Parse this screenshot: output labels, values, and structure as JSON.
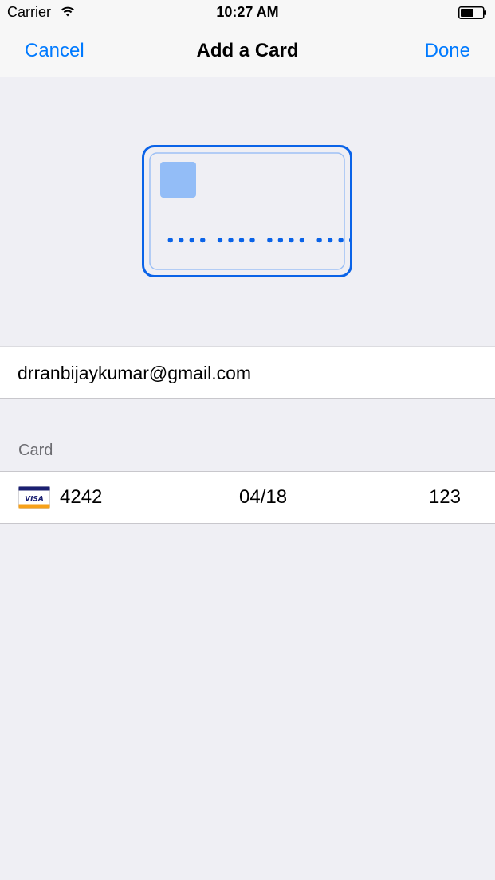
{
  "status_bar": {
    "carrier": "Carrier",
    "time": "10:27 AM",
    "icons": [
      "wifi-icon",
      "battery-icon"
    ]
  },
  "nav": {
    "cancel_label": "Cancel",
    "title": "Add a Card",
    "done_label": "Done"
  },
  "card_illustration": {
    "number_mask": "•••• •••• •••• ••••"
  },
  "email_field": {
    "value": "drranbijaykumar@gmail.com"
  },
  "card_section": {
    "header": "Card",
    "brand_icon": "visa-icon",
    "brand_text": "VISA",
    "number": "4242",
    "expiry": "04/18",
    "cvc": "123"
  },
  "colors": {
    "accent": "#007aff",
    "background": "#efeff4",
    "card_chip": "#93bdf7",
    "visa_blue": "#1a1f71",
    "visa_gold": "#f7a11a"
  }
}
